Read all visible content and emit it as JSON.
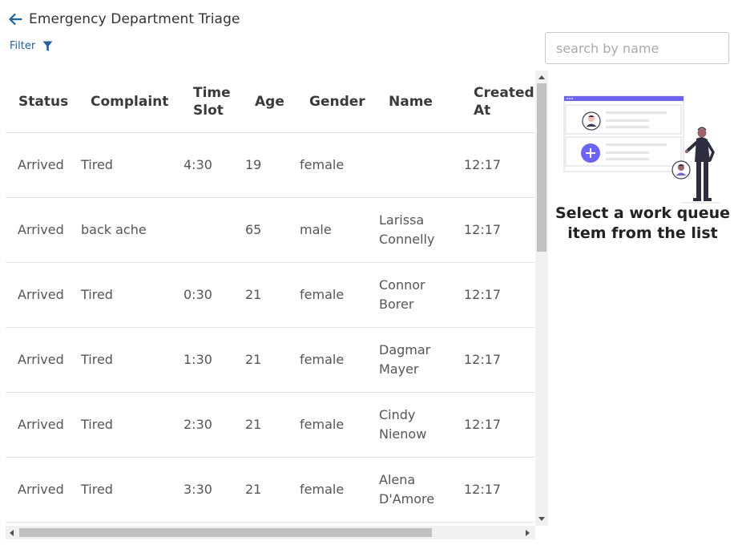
{
  "header": {
    "title": "Emergency Department Triage",
    "back_icon": "arrow-left-icon"
  },
  "filter": {
    "label": "Filter",
    "icon": "funnel-icon",
    "color": "#1f5fa8"
  },
  "search": {
    "placeholder": "search by name",
    "value": ""
  },
  "table": {
    "columns": [
      "Status",
      "Complaint",
      "Time\nSlot",
      "Age",
      "Gender",
      "Name",
      "Created\nAt"
    ],
    "rows": [
      {
        "status": "Arrived",
        "complaint": "Tired",
        "time_slot": "4:30",
        "age": "19",
        "gender": "female",
        "name": "",
        "created_at": "12:17"
      },
      {
        "status": "Arrived",
        "complaint": "back ache",
        "time_slot": "",
        "age": "65",
        "gender": "male",
        "name": "Larissa Connelly",
        "created_at": "12:17"
      },
      {
        "status": "Arrived",
        "complaint": "Tired",
        "time_slot": "0:30",
        "age": "21",
        "gender": "female",
        "name": "Connor Borer",
        "created_at": "12:17"
      },
      {
        "status": "Arrived",
        "complaint": "Tired",
        "time_slot": "1:30",
        "age": "21",
        "gender": "female",
        "name": "Dagmar Mayer",
        "created_at": "12:17"
      },
      {
        "status": "Arrived",
        "complaint": "Tired",
        "time_slot": "2:30",
        "age": "21",
        "gender": "female",
        "name": "Cindy Nienow",
        "created_at": "12:17"
      },
      {
        "status": "Arrived",
        "complaint": "Tired",
        "time_slot": "3:30",
        "age": "21",
        "gender": "female",
        "name": "Alena D'Amore",
        "created_at": "12:17"
      }
    ]
  },
  "side_panel": {
    "illustration": "work-queue-illustration",
    "accent_color": "#6c63ff",
    "message": "Select a work queue item from the list"
  }
}
